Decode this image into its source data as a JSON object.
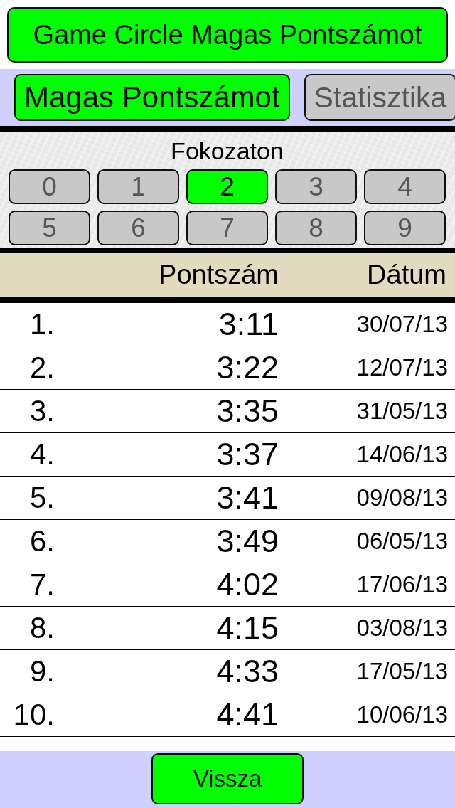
{
  "title_button": {
    "label": "Game Circle Magas Pontszámot"
  },
  "tabs": [
    {
      "label": "Magas Pontszámot",
      "selected": true
    },
    {
      "label": "Statisztika",
      "selected": false
    }
  ],
  "level_picker": {
    "label": "Fokozaton",
    "levels": [
      {
        "label": "0",
        "selected": false
      },
      {
        "label": "1",
        "selected": false
      },
      {
        "label": "2",
        "selected": true
      },
      {
        "label": "3",
        "selected": false
      },
      {
        "label": "4",
        "selected": false
      },
      {
        "label": "5",
        "selected": false
      },
      {
        "label": "6",
        "selected": false
      },
      {
        "label": "7",
        "selected": false
      },
      {
        "label": "8",
        "selected": false
      },
      {
        "label": "9",
        "selected": false
      }
    ]
  },
  "table": {
    "columns": [
      "Pontszám",
      "Dátum"
    ],
    "rows": [
      {
        "rank": "1.",
        "score": "3:11",
        "date": "30/07/13"
      },
      {
        "rank": "2.",
        "score": "3:22",
        "date": "12/07/13"
      },
      {
        "rank": "3.",
        "score": "3:35",
        "date": "31/05/13"
      },
      {
        "rank": "4.",
        "score": "3:37",
        "date": "14/06/13"
      },
      {
        "rank": "5.",
        "score": "3:41",
        "date": "09/08/13"
      },
      {
        "rank": "6.",
        "score": "3:49",
        "date": "06/05/13"
      },
      {
        "rank": "7.",
        "score": "4:02",
        "date": "17/06/13"
      },
      {
        "rank": "8.",
        "score": "4:15",
        "date": "03/08/13"
      },
      {
        "rank": "9.",
        "score": "4:33",
        "date": "17/05/13"
      },
      {
        "rank": "10.",
        "score": "4:41",
        "date": "10/06/13"
      }
    ]
  },
  "back_button": {
    "label": "Vissza"
  }
}
